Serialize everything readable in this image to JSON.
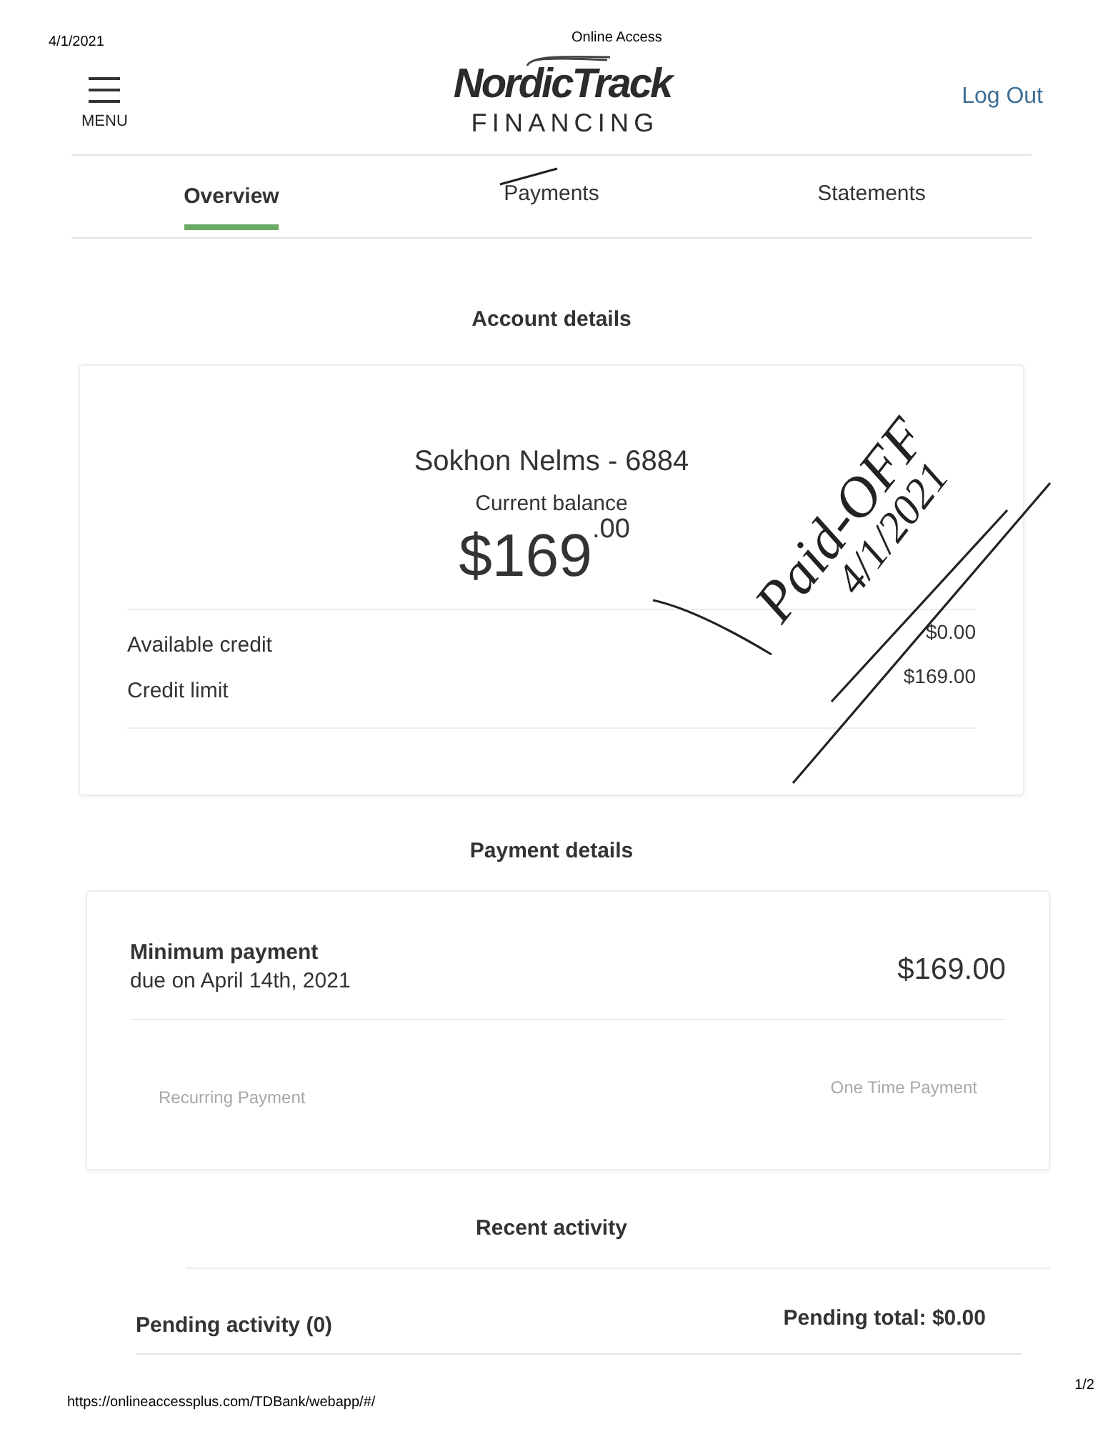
{
  "header": {
    "date": "4/1/2021",
    "page_title": "Online Access",
    "menu_label": "MENU",
    "logo": {
      "brand": "NordicTrack",
      "subtitle": "FINANCING"
    },
    "logout": "Log Out"
  },
  "tabs": [
    {
      "label": "Overview",
      "selected": true
    },
    {
      "label": "Payments",
      "selected": false
    },
    {
      "label": "Statements",
      "selected": false
    }
  ],
  "account_details": {
    "heading": "Account details",
    "account_name": "Sokhon Nelms - 6884",
    "balance_label": "Current balance",
    "balance": "$169$^{.00}$",
    "rows": [
      {
        "label": "Available credit",
        "value": "$0.00"
      },
      {
        "label": "Credit limit",
        "value": "$169.00"
      }
    ]
  },
  "payment_details": {
    "heading": "Payment details",
    "minimum_label": "Minimum payment",
    "due": "due on April 14th, 2021",
    "amount": "$169.00",
    "buttons": [
      "Recurring Payment",
      "One Time Payment"
    ]
  },
  "recent_activity": {
    "heading": "Recent activity",
    "pending_label": "Pending activity (0)",
    "pending_total": "Pending total: $0.00"
  },
  "handwritten_note": [
    "Paid-OFF",
    "4/1/2021"
  ],
  "footer": {
    "url": "https://onlineaccessplus.com/TDBank/webapp/#/",
    "page": "1/2"
  }
}
